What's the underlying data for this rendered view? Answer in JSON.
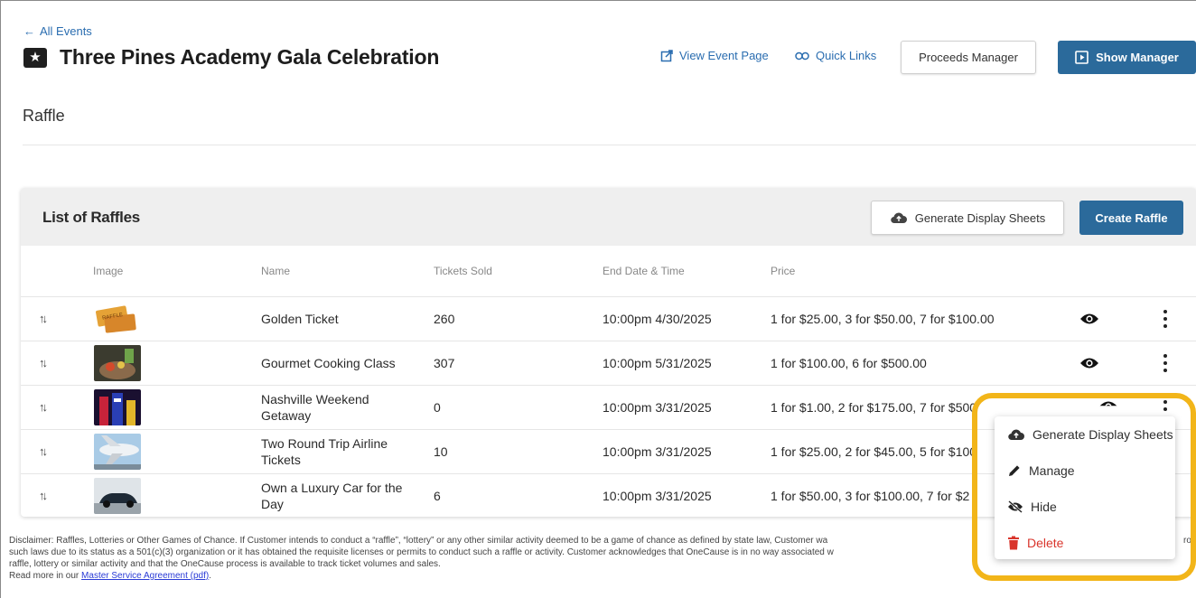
{
  "header": {
    "back_label": "All Events",
    "event_title": "Three Pines Academy Gala Celebration",
    "view_event_page": "View Event Page",
    "quick_links": "Quick Links",
    "proceeds_manager": "Proceeds Manager",
    "show_manager": "Show Manager"
  },
  "section_title": "Raffle",
  "card": {
    "title": "List of Raffles",
    "generate_display_sheets": "Generate Display Sheets",
    "create_raffle": "Create Raffle"
  },
  "columns": {
    "image": "Image",
    "name": "Name",
    "tickets_sold": "Tickets Sold",
    "end_date_time": "End Date & Time",
    "price": "Price"
  },
  "rows": [
    {
      "name_line1": "Golden Ticket",
      "name_line2": "",
      "tickets_sold": "260",
      "end": "10:00pm 4/30/2025",
      "price": "1 for $25.00, 3 for $50.00, 7 for $100.00"
    },
    {
      "name_line1": "Gourmet Cooking Class",
      "name_line2": "",
      "tickets_sold": "307",
      "end": "10:00pm 5/31/2025",
      "price": "1 for $100.00, 6 for $500.00"
    },
    {
      "name_line1": "Nashville Weekend",
      "name_line2": "Getaway",
      "tickets_sold": "0",
      "end": "10:00pm 3/31/2025",
      "price": "1 for $1.00, 2 for $175.00, 7 for $500"
    },
    {
      "name_line1": "Two Round Trip Airline",
      "name_line2": "Tickets",
      "tickets_sold": "10",
      "end": "10:00pm 3/31/2025",
      "price": "1 for $25.00, 2 for $45.00, 5 for $100"
    },
    {
      "name_line1": "Own a Luxury Car for the",
      "name_line2": "Day",
      "tickets_sold": "6",
      "end": "10:00pm 3/31/2025",
      "price": "1 for $50.00, 3 for $100.00, 7 for $2"
    }
  ],
  "context_menu": {
    "generate_display_sheets": "Generate Display Sheets",
    "manage": "Manage",
    "hide": "Hide",
    "delete": "Delete",
    "delete_color": "#d9352c"
  },
  "disclaimer": {
    "line1": "Disclaimer: Raffles, Lotteries or Other Games of Chance. If Customer intends to conduct a “raffle”, “lottery” or any other similar activity deemed to be a game of chance as defined by state law, Customer wa",
    "line1_tail": "rom",
    "line2": "such laws due to its status as a 501(c)(3) organization or it has obtained the requisite licenses or permits to conduct such a raffle or activity. Customer acknowledges that OneCause is in no way associated w",
    "line3": "raffle, lottery or similar activity and that the OneCause process is available to track ticket volumes and sales.",
    "read_more_prefix": "Read more in our ",
    "link_text": "Master Service Agreement (pdf)",
    "suffix": "."
  },
  "colors": {
    "accent": "#2b6a9b",
    "link": "#2a6db0",
    "highlight": "#f2b519"
  }
}
